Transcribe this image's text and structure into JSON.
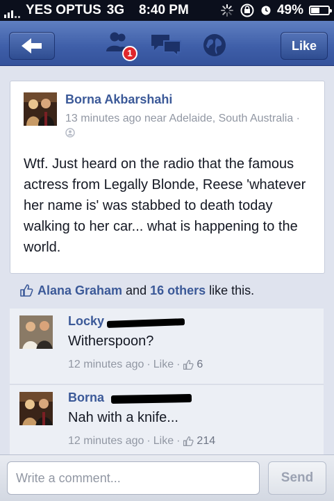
{
  "status_bar": {
    "carrier": "YES OPTUS",
    "network": "3G",
    "time": "8:40 PM",
    "battery": "49%",
    "battery_level": 0.49,
    "signal_bars": 5
  },
  "nav": {
    "back_icon": "back-arrow-icon",
    "friend_requests_icon": "friend-requests-icon",
    "friend_requests_badge": "1",
    "messages_icon": "messages-icon",
    "notifications_icon": "globe-icon",
    "like_label": "Like"
  },
  "post": {
    "author": "Borna Akbarshahi",
    "meta": "13 minutes ago near Adelaide, South Australia · ",
    "privacy_icon": "friends-icon",
    "text": "Wtf. Just heard on the radio that the famous actress from Legally Blonde, Reese 'whatever her name is' was stabbed to death today walking to her car... what is happening to the world."
  },
  "likes": {
    "icon": "thumbs-up-icon",
    "name": "Alana Graham",
    "and": " and ",
    "others": "16 others",
    "suffix": " like this."
  },
  "comments": [
    {
      "name": "Locky",
      "text": "Witherspoon?",
      "time": "12 minutes ago",
      "sep": "·",
      "like": "Like",
      "like_count": "6"
    },
    {
      "name": "Borna",
      "text": "Nah with a knife...",
      "time": "12 minutes ago",
      "sep": "·",
      "like": "Like",
      "like_count": "214"
    }
  ],
  "composer": {
    "placeholder": "Write a comment...",
    "send_label": "Send"
  },
  "colors": {
    "facebook_blue": "#3b5998",
    "nav_blue": "#3e5ea8",
    "badge_red": "#e0272c"
  }
}
